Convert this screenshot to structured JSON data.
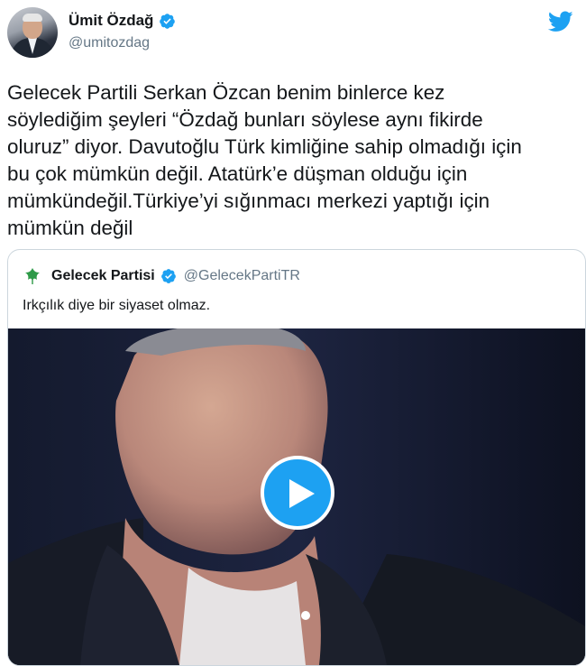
{
  "author": {
    "name": "Ümit Özdağ",
    "handle": "@umitozdag"
  },
  "tweet": {
    "lines": [
      "Gelecek Partili Serkan Özcan benim binlerce kez",
      "söylediğim şeyleri “Özdağ bunları söylese aynı fikirde",
      "oluruz” diyor. Davutoğlu Türk kimliğine sahip olmadığı için",
      "bu çok mümkün değil. Atatürk’e düşman olduğu için",
      "mümkündeğil.Türkiye’yi sığınmacı merkezi yaptığı için",
      "mümkün değil"
    ]
  },
  "quoted": {
    "name": "Gelecek Partisi",
    "handle": "@GelecekPartiTR",
    "text": "Irkçılık diye bir siyaset olmaz."
  },
  "colors": {
    "twitter_blue": "#1da1f2",
    "handle_gray": "#657786",
    "border": "#ccd6dd"
  },
  "icons": {
    "verified": "verified-badge-icon",
    "brand": "twitter-bird-icon",
    "play": "play-icon",
    "party_logo": "gelecek-partisi-leaf-logo"
  }
}
